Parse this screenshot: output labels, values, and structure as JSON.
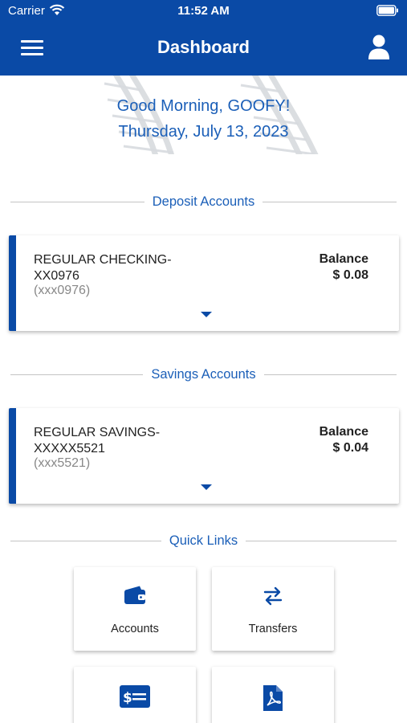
{
  "status_bar": {
    "carrier": "Carrier",
    "time": "11:52 AM"
  },
  "header": {
    "title": "Dashboard",
    "menu_icon": "hamburger-menu-icon",
    "profile_icon": "user-icon"
  },
  "greeting": {
    "line1": "Good Morning, GOOFY!",
    "line2": "Thursday, July 13, 2023"
  },
  "deposit_section": {
    "heading": "Deposit Accounts",
    "account": {
      "name_line1": "REGULAR CHECKING-",
      "name_line2": "XX0976",
      "mask": "(xxx0976)",
      "balance_label": "Balance",
      "balance": "$ 0.08"
    }
  },
  "savings_section": {
    "heading": "Savings Accounts",
    "account": {
      "name_line1": "REGULAR SAVINGS-",
      "name_line2": "XXXXX5521",
      "mask": "(xxx5521)",
      "balance_label": "Balance",
      "balance": "$ 0.04"
    }
  },
  "quick_links": {
    "heading": "Quick Links",
    "items": [
      {
        "label": "Accounts",
        "icon": "wallet-icon"
      },
      {
        "label": "Transfers",
        "icon": "transfer-arrows-icon"
      },
      {
        "label": "",
        "icon": "check-icon"
      },
      {
        "label": "",
        "icon": "pdf-document-icon"
      }
    ]
  },
  "colors": {
    "primary": "#0a4aa6",
    "accent_text": "#1b5fb8",
    "muted_text": "#888888"
  }
}
